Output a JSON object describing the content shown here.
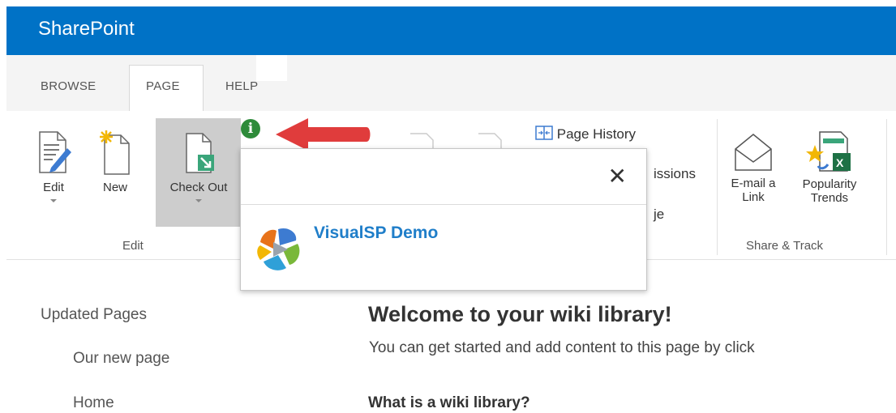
{
  "suite": {
    "brand": "SharePoint"
  },
  "tabs": [
    {
      "label": "BROWSE"
    },
    {
      "label": "PAGE"
    },
    {
      "label": "HELP"
    }
  ],
  "ribbon": {
    "edit_group": {
      "buttons": [
        {
          "label": "Edit"
        },
        {
          "label": "New"
        },
        {
          "label": "Check Out"
        }
      ],
      "label": "Edit"
    },
    "manage_items": [
      {
        "label": "Page History"
      },
      {
        "label": "issions"
      },
      {
        "label": "je"
      }
    ],
    "share_group": {
      "buttons": [
        {
          "label_line1": "E-mail a",
          "label_line2": "Link"
        },
        {
          "label_line1": "Popularity",
          "label_line2": "Trends"
        }
      ],
      "label": "Share & Track"
    }
  },
  "popup": {
    "close_glyph": "✕",
    "site_name": "VisualSP Demo"
  },
  "info_icon_glyph": "i",
  "quick_launch": {
    "heading": "Updated Pages",
    "items": [
      "Our new page",
      "Home"
    ]
  },
  "content": {
    "title": "Welcome to your wiki library!",
    "intro": "You can get started and add content to this page by click",
    "subheading": "What is a wiki library?"
  },
  "colors": {
    "suitebar": "#0072c6",
    "accent_link": "#1f7ec9",
    "info_icon": "#2e8b3a",
    "arrow": "#e03c3c"
  }
}
